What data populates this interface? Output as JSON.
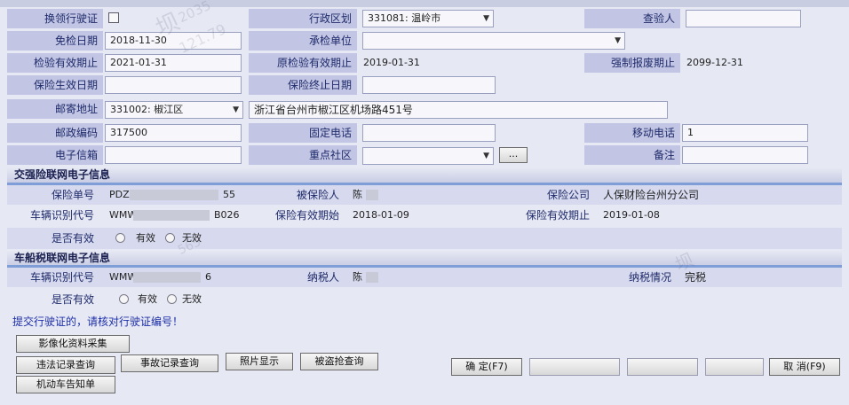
{
  "form": {
    "replace_license": {
      "label": "换领行驶证",
      "checked": false
    },
    "admin_region": {
      "label": "行政区划",
      "value": "331081: 温岭市"
    },
    "inspector": {
      "label": "查验人",
      "value": ""
    },
    "exempt_date": {
      "label": "免检日期",
      "value": "2018-11-30"
    },
    "inspection_unit": {
      "label": "承检单位",
      "value": ""
    },
    "inspection_valid_until": {
      "label": "检验有效期止",
      "value": "2021-01-31"
    },
    "orig_inspection_valid_until": {
      "label": "原检验有效期止",
      "value": "2019-01-31"
    },
    "forced_scrap_date": {
      "label": "强制报废期止",
      "value": "2099-12-31"
    },
    "insurance_start": {
      "label": "保险生效日期",
      "value": ""
    },
    "insurance_end": {
      "label": "保险终止日期",
      "value": ""
    },
    "mail_address": {
      "label": "邮寄地址",
      "region": "331002: 椒江区",
      "detail": "浙江省台州市椒江区机场路451号"
    },
    "postal_code": {
      "label": "邮政编码",
      "value": "317500"
    },
    "landline": {
      "label": "固定电话",
      "value": ""
    },
    "mobile": {
      "label": "移动电话",
      "value": "1"
    },
    "email": {
      "label": "电子信箱",
      "value": ""
    },
    "key_community": {
      "label": "重点社区",
      "value": "",
      "browse_label": "..."
    },
    "remarks": {
      "label": "备注",
      "value": ""
    }
  },
  "compulsory_insurance": {
    "title": "交强险联网电子信息",
    "policy_no": {
      "label": "保险单号",
      "value": "PDZA",
      "suffix": "55"
    },
    "insured": {
      "label": "被保险人",
      "value": "陈"
    },
    "company": {
      "label": "保险公司",
      "value": "人保财险台州分公司"
    },
    "vin": {
      "label": "车辆识别代号",
      "value": "WMW",
      "suffix": "B026"
    },
    "start": {
      "label": "保险有效期始",
      "value": "2018-01-09"
    },
    "end": {
      "label": "保险有效期止",
      "value": "2019-01-08"
    },
    "validity": {
      "label": "是否有效",
      "opt1": "有效",
      "opt2": "无效"
    }
  },
  "vehicle_tax": {
    "title": "车船税联网电子信息",
    "vin": {
      "label": "车辆识别代号",
      "value": "WMW",
      "suffix": "6"
    },
    "taxpayer": {
      "label": "纳税人",
      "value": "陈"
    },
    "tax_status": {
      "label": "纳税情况",
      "value": "完税"
    },
    "validity": {
      "label": "是否有效",
      "opt1": "有效",
      "opt2": "无效"
    }
  },
  "notice": "提交行驶证的，请核对行驶证编号！",
  "buttons": {
    "image_collect": "影像化资料采集",
    "violation_query": "违法记录查询",
    "accident_query": "事故记录查询",
    "photo_display": "照片显示",
    "theft_query": "被盗抢查询",
    "vehicle_notice": "机动车告知单",
    "confirm": "确 定(F7)",
    "disabled1": "",
    "disabled2": "",
    "disabled3": "",
    "cancel": "取 消(F9)"
  },
  "watermarks": [
    "坝",
    "2035",
    "121.79",
    "坝",
    "565"
  ]
}
